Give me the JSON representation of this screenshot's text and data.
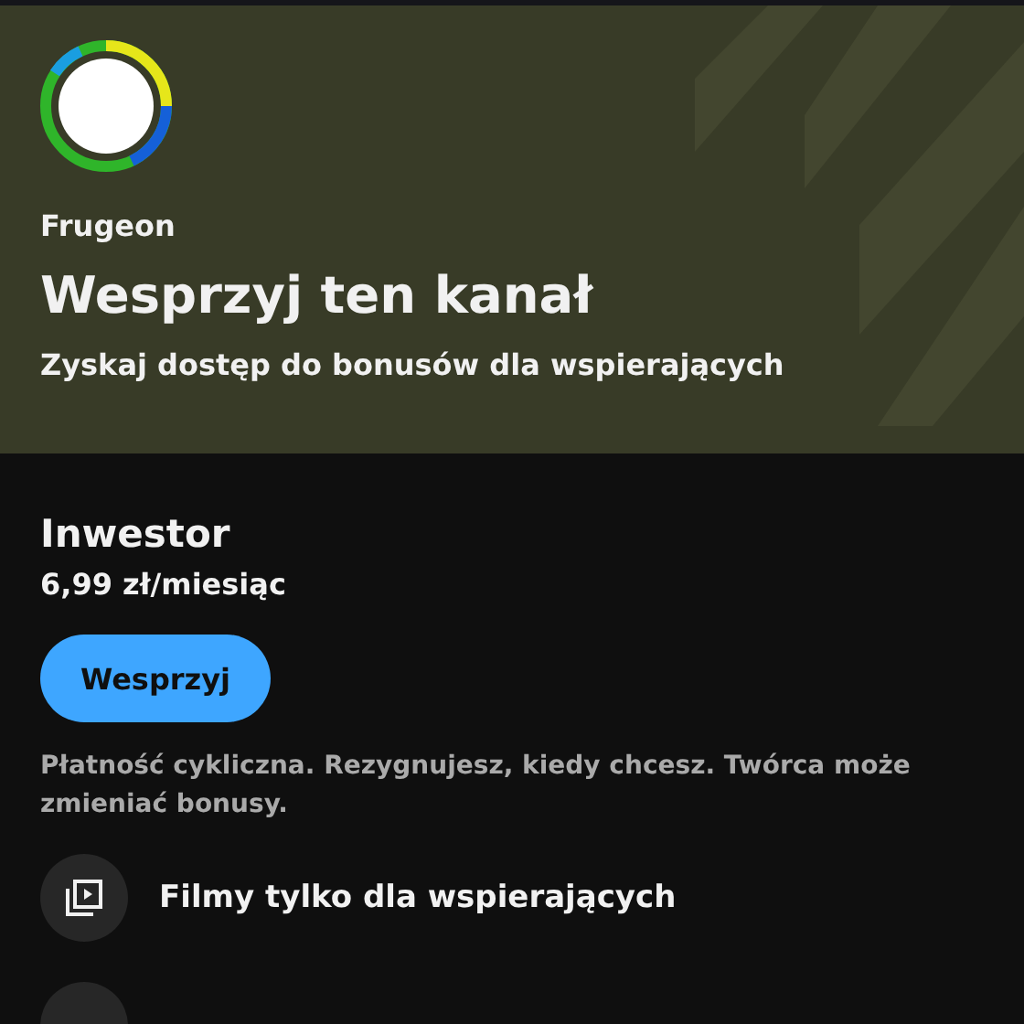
{
  "channel": {
    "name": "Frugeon"
  },
  "header": {
    "title": "Wesprzyj ten kanał",
    "subtitle": "Zyskaj dostęp do bonusów dla wspierających"
  },
  "tier": {
    "name": "Inwestor",
    "price": "6,99 zł/miesiąc",
    "button": "Wesprzyj",
    "note": "Płatność cykliczna. Rezygnujesz, kiedy chcesz. Twórca może zmieniać bonusy."
  },
  "perks": [
    {
      "kind": "videos",
      "label": "Filmy tylko dla wspierających"
    }
  ]
}
